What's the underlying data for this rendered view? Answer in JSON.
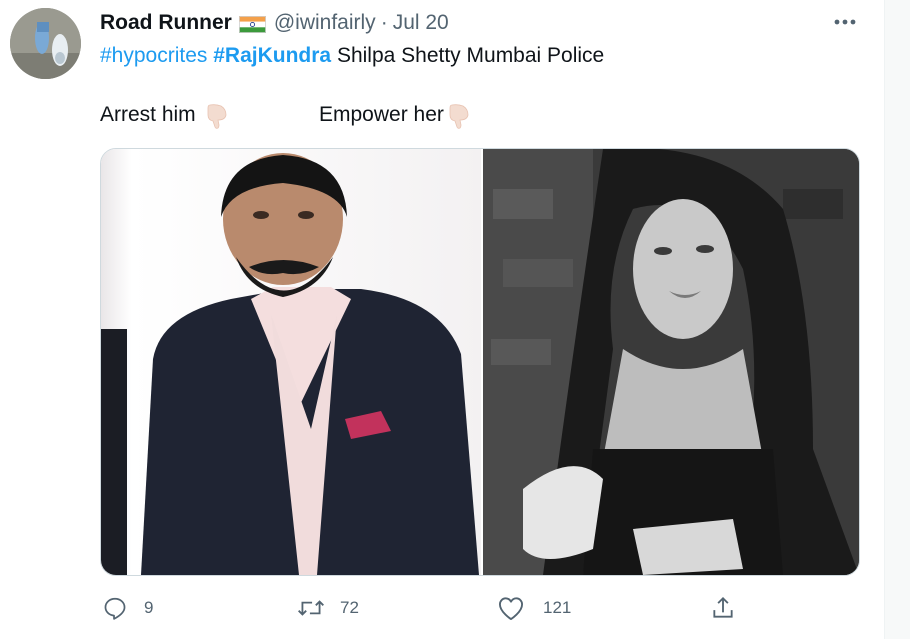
{
  "author": {
    "display_name": "Road Runner",
    "flag_icon": "india-flag-icon",
    "handle": "@iwinfairly",
    "separator": "·",
    "date": "Jul 20"
  },
  "tweet": {
    "hashtag_1": "#hypocrites",
    "hashtag_2": "#RajKundra",
    "text_rest": "Shilpa Shetty Mumbai Police",
    "caption_left": "Arrest him",
    "caption_right": "Empower her",
    "caption_emoji": "backhand-index-pointing-down-emoji"
  },
  "actions": {
    "reply_count": "9",
    "retweet_count": "72",
    "like_count": "121"
  },
  "colors": {
    "link": "#1d9bf0",
    "secondary_text": "#536471",
    "border": "#cfd9de"
  }
}
